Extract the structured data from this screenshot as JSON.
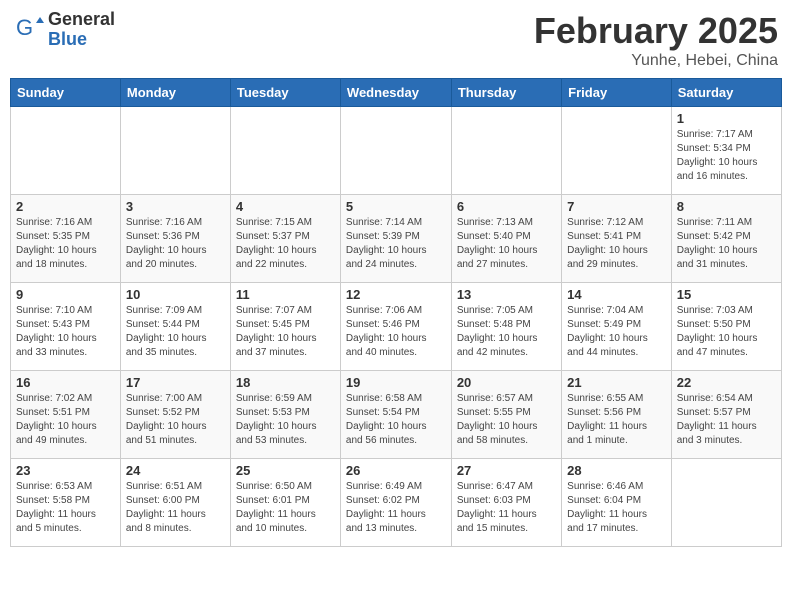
{
  "header": {
    "logo_general": "General",
    "logo_blue": "Blue",
    "month_title": "February 2025",
    "location": "Yunhe, Hebei, China"
  },
  "weekdays": [
    "Sunday",
    "Monday",
    "Tuesday",
    "Wednesday",
    "Thursday",
    "Friday",
    "Saturday"
  ],
  "weeks": [
    [
      {
        "day": "",
        "info": ""
      },
      {
        "day": "",
        "info": ""
      },
      {
        "day": "",
        "info": ""
      },
      {
        "day": "",
        "info": ""
      },
      {
        "day": "",
        "info": ""
      },
      {
        "day": "",
        "info": ""
      },
      {
        "day": "1",
        "info": "Sunrise: 7:17 AM\nSunset: 5:34 PM\nDaylight: 10 hours\nand 16 minutes."
      }
    ],
    [
      {
        "day": "2",
        "info": "Sunrise: 7:16 AM\nSunset: 5:35 PM\nDaylight: 10 hours\nand 18 minutes."
      },
      {
        "day": "3",
        "info": "Sunrise: 7:16 AM\nSunset: 5:36 PM\nDaylight: 10 hours\nand 20 minutes."
      },
      {
        "day": "4",
        "info": "Sunrise: 7:15 AM\nSunset: 5:37 PM\nDaylight: 10 hours\nand 22 minutes."
      },
      {
        "day": "5",
        "info": "Sunrise: 7:14 AM\nSunset: 5:39 PM\nDaylight: 10 hours\nand 24 minutes."
      },
      {
        "day": "6",
        "info": "Sunrise: 7:13 AM\nSunset: 5:40 PM\nDaylight: 10 hours\nand 27 minutes."
      },
      {
        "day": "7",
        "info": "Sunrise: 7:12 AM\nSunset: 5:41 PM\nDaylight: 10 hours\nand 29 minutes."
      },
      {
        "day": "8",
        "info": "Sunrise: 7:11 AM\nSunset: 5:42 PM\nDaylight: 10 hours\nand 31 minutes."
      }
    ],
    [
      {
        "day": "9",
        "info": "Sunrise: 7:10 AM\nSunset: 5:43 PM\nDaylight: 10 hours\nand 33 minutes."
      },
      {
        "day": "10",
        "info": "Sunrise: 7:09 AM\nSunset: 5:44 PM\nDaylight: 10 hours\nand 35 minutes."
      },
      {
        "day": "11",
        "info": "Sunrise: 7:07 AM\nSunset: 5:45 PM\nDaylight: 10 hours\nand 37 minutes."
      },
      {
        "day": "12",
        "info": "Sunrise: 7:06 AM\nSunset: 5:46 PM\nDaylight: 10 hours\nand 40 minutes."
      },
      {
        "day": "13",
        "info": "Sunrise: 7:05 AM\nSunset: 5:48 PM\nDaylight: 10 hours\nand 42 minutes."
      },
      {
        "day": "14",
        "info": "Sunrise: 7:04 AM\nSunset: 5:49 PM\nDaylight: 10 hours\nand 44 minutes."
      },
      {
        "day": "15",
        "info": "Sunrise: 7:03 AM\nSunset: 5:50 PM\nDaylight: 10 hours\nand 47 minutes."
      }
    ],
    [
      {
        "day": "16",
        "info": "Sunrise: 7:02 AM\nSunset: 5:51 PM\nDaylight: 10 hours\nand 49 minutes."
      },
      {
        "day": "17",
        "info": "Sunrise: 7:00 AM\nSunset: 5:52 PM\nDaylight: 10 hours\nand 51 minutes."
      },
      {
        "day": "18",
        "info": "Sunrise: 6:59 AM\nSunset: 5:53 PM\nDaylight: 10 hours\nand 53 minutes."
      },
      {
        "day": "19",
        "info": "Sunrise: 6:58 AM\nSunset: 5:54 PM\nDaylight: 10 hours\nand 56 minutes."
      },
      {
        "day": "20",
        "info": "Sunrise: 6:57 AM\nSunset: 5:55 PM\nDaylight: 10 hours\nand 58 minutes."
      },
      {
        "day": "21",
        "info": "Sunrise: 6:55 AM\nSunset: 5:56 PM\nDaylight: 11 hours\nand 1 minute."
      },
      {
        "day": "22",
        "info": "Sunrise: 6:54 AM\nSunset: 5:57 PM\nDaylight: 11 hours\nand 3 minutes."
      }
    ],
    [
      {
        "day": "23",
        "info": "Sunrise: 6:53 AM\nSunset: 5:58 PM\nDaylight: 11 hours\nand 5 minutes."
      },
      {
        "day": "24",
        "info": "Sunrise: 6:51 AM\nSunset: 6:00 PM\nDaylight: 11 hours\nand 8 minutes."
      },
      {
        "day": "25",
        "info": "Sunrise: 6:50 AM\nSunset: 6:01 PM\nDaylight: 11 hours\nand 10 minutes."
      },
      {
        "day": "26",
        "info": "Sunrise: 6:49 AM\nSunset: 6:02 PM\nDaylight: 11 hours\nand 13 minutes."
      },
      {
        "day": "27",
        "info": "Sunrise: 6:47 AM\nSunset: 6:03 PM\nDaylight: 11 hours\nand 15 minutes."
      },
      {
        "day": "28",
        "info": "Sunrise: 6:46 AM\nSunset: 6:04 PM\nDaylight: 11 hours\nand 17 minutes."
      },
      {
        "day": "",
        "info": ""
      }
    ]
  ]
}
